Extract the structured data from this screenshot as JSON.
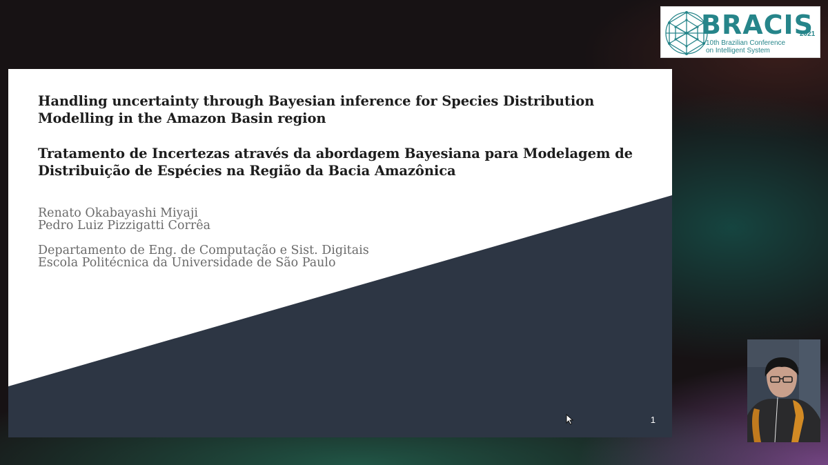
{
  "slide": {
    "title_en": [
      "Handling uncertainty through Bayesian inference for Species Distribution",
      "Modelling in the Amazon Basin region"
    ],
    "title_pt": [
      "Tratamento de Incertezas através da abordagem Bayesiana para Modelagem de",
      "Distribuição de Espécies na Região da Bacia Amazônica"
    ],
    "authors": [
      "Renato Okabayashi Miyaji",
      "Pedro Luiz Pizzigatti Corrêa"
    ],
    "affiliation": [
      "Departamento de Eng. de Computação e Sist. Digitais",
      "Escola Politécnica da Universidade de São Paulo"
    ],
    "page_number": "1",
    "shape_color": "#2d3644"
  },
  "logo": {
    "wordmark": "BRACIS",
    "year": "2021",
    "subtitle": [
      "10th Brazilian Conference",
      "on Intelligent System"
    ],
    "brand_color": "#26858a",
    "icon": "globe-network-icon"
  },
  "webcam": {
    "icon": "presenter-video-feed"
  },
  "cursor": {
    "icon": "mouse-pointer-icon"
  }
}
